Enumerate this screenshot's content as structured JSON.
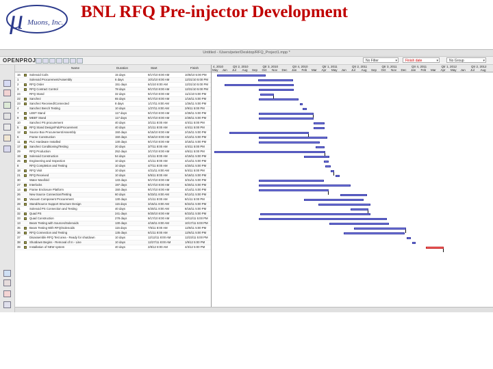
{
  "slide": {
    "title": "BNL RFQ Pre-injector Development",
    "logo": {
      "symbol": "μ",
      "text": "Muons, Inc."
    }
  },
  "window": {
    "path": "Untitled - /Users/peter/Desktop/RFQ_Project1.mpp *",
    "brand": "OPENPROJ",
    "filter_select": "No Filter",
    "sort_select": "Finish date",
    "group_select": "No Group"
  },
  "columns": {
    "id": "",
    "name": "Name",
    "duration": "Duration",
    "start": "Start",
    "finish": "Finish"
  },
  "colors": {
    "bar": "#7b7fe0",
    "critical_bar": "#ff6f6f",
    "title": "#c00000"
  },
  "timeline": {
    "quarters": [
      "4, 2010",
      "Qtr 2, 2010",
      "Qtr 3, 2010",
      "Qtr 4, 2010",
      "Qtr 1, 2011",
      "Qtr 2, 2011",
      "Qtr 3, 2011",
      "Qtr 4, 2011",
      "Qtr 1, 2012",
      "Qtr 2, 2012",
      "Qtr 3, 2012"
    ],
    "months": [
      "May",
      "Jun",
      "Jul",
      "Aug",
      "Sep",
      "Oct",
      "Nov",
      "Dec",
      "Jan",
      "Feb",
      "Mar",
      "Apr",
      "May",
      "Jun",
      "Jul",
      "Aug",
      "Sep",
      "Oct",
      "Nov",
      "Dec",
      "Jan",
      "Feb",
      "Mar",
      "Apr",
      "May",
      "Jun",
      "Jul",
      "Aug"
    ]
  },
  "tasks": [
    {
      "id": "16",
      "name": "Solenoid Coils",
      "duration": "15 days",
      "start": "9/17/10 8:00 AM",
      "finish": "10/8/10 5:00 PM",
      "start_month": 0.3,
      "end_month": 5.2,
      "critical": false
    },
    {
      "id": "1",
      "name": "Solenoid Procurement/Assembly",
      "duration": "6 days",
      "start": "10/1/10 8:00 AM",
      "finish": "12/31/10 5:00 PM",
      "start_month": 4.4,
      "end_month": 7.9,
      "critical": false
    },
    {
      "id": "2",
      "name": "RFQ Order",
      "duration": "151 days",
      "start": "6/1/10 8:00 AM",
      "finish": "12/31/10 5:00 PM",
      "start_month": 1.0,
      "end_month": 8.0,
      "critical": false
    },
    {
      "id": "3",
      "name": "RFQ Contract Control",
      "duration": "78 days",
      "start": "9/17/10 8:00 AM",
      "finish": "12/31/10 5:00 PM",
      "start_month": 4.5,
      "end_month": 8.0,
      "critical": false
    },
    {
      "id": "24",
      "name": "RFQ Stand",
      "duration": "32 days",
      "start": "9/17/10 8:00 AM",
      "finish": "11/1/10 5:00 PM",
      "start_month": 4.6,
      "end_month": 6.0,
      "critical": false
    },
    {
      "id": "22",
      "name": "Sanchez",
      "duration": "65 days",
      "start": "9/17/10 8:00 AM",
      "finish": "1/16/11 5:00 PM",
      "start_month": 4.5,
      "end_month": 8.5,
      "critical": false
    },
    {
      "id": "23",
      "name": "Sanchez Received/Connected",
      "duration": "8 days",
      "start": "1/17/11 8:00 AM",
      "finish": "1/26/11 5:00 PM",
      "start_month": 8.6,
      "end_month": 8.9,
      "critical": false
    },
    {
      "id": "4",
      "name": "Sanchez Bench Testing",
      "duration": "10 days",
      "start": "1/27/11 8:00 AM",
      "finish": "2/9/11 5:00 PM",
      "start_month": 8.9,
      "end_month": 9.3,
      "critical": false
    },
    {
      "id": "7",
      "name": "LEBT Stand",
      "duration": "117 days",
      "start": "9/17/10 8:00 AM",
      "finish": "2/28/11 5:00 PM",
      "start_month": 4.5,
      "end_month": 10.0,
      "critical": false
    },
    {
      "id": "9",
      "name": "MEBT Stand",
      "duration": "117 days",
      "start": "9/17/10 8:00 AM",
      "finish": "2/28/11 5:00 PM",
      "start_month": 4.5,
      "end_month": 10.0,
      "critical": false
    },
    {
      "id": "10",
      "name": "Sanchez PS procurement",
      "duration": "40 days",
      "start": "3/1/11 8:00 AM",
      "finish": "4/4/11 5:00 PM",
      "start_month": 10.0,
      "end_month": 11.1,
      "critical": false
    },
    {
      "id": "5",
      "name": "RFQ Stand Design/Fab/Procurement",
      "duration": "40 days",
      "start": "3/1/11 8:00 AM",
      "finish": "4/4/11 5:00 PM",
      "start_month": 10.0,
      "end_month": 11.1,
      "critical": false
    },
    {
      "id": "12",
      "name": "Source Box Procurement/Assembly",
      "duration": "150 days",
      "start": "6/15/10 8:00 AM",
      "finish": "2/15/11 5:00 PM",
      "start_month": 1.5,
      "end_month": 9.5,
      "critical": false
    },
    {
      "id": "6",
      "name": "Frame Construction",
      "duration": "150 days",
      "start": "9/16/10 8:00 AM",
      "finish": "4/13/11 5:00 PM",
      "start_month": 4.5,
      "end_month": 11.4,
      "critical": false
    },
    {
      "id": "11",
      "name": "PLC Hardware Installed",
      "duration": "130 days",
      "start": "9/17/10 8:00 AM",
      "finish": "3/18/11 5:00 PM",
      "start_month": 4.5,
      "end_month": 10.6,
      "critical": false
    },
    {
      "id": "17",
      "name": "Sanchez Conditioning/Testing",
      "duration": "20 days",
      "start": "3/7/11 8:00 AM",
      "finish": "4/4/11 5:00 PM",
      "start_month": 10.2,
      "end_month": 11.1,
      "critical": false
    },
    {
      "id": "29",
      "name": "RFQ Production",
      "duration": "252 days",
      "start": "3/17/10 8:00 AM",
      "finish": "4/6/11 5:00 PM",
      "start_month": 0.0,
      "end_month": 11.2,
      "critical": false
    },
    {
      "id": "19",
      "name": "Solenoid Construction",
      "duration": "54 days",
      "start": "2/1/11 8:00 AM",
      "finish": "4/19/11 5:00 PM",
      "start_month": 9.0,
      "end_month": 11.6,
      "critical": false
    },
    {
      "id": "25",
      "name": "Engineering and Inspection",
      "duration": "10 days",
      "start": "4/1/11 8:00 AM",
      "finish": "4/14/11 5:00 PM",
      "start_month": 11.0,
      "end_month": 11.5,
      "critical": false
    },
    {
      "id": "8",
      "name": "RFQ Completion and Testing",
      "duration": "10 days",
      "start": "4/7/11 8:00 AM",
      "finish": "4/20/11 5:00 PM",
      "start_month": 11.2,
      "end_month": 11.7,
      "critical": false
    },
    {
      "id": "18",
      "name": "RFQ Visit",
      "duration": "10 days",
      "start": "4/21/11 8:00 AM",
      "finish": "5/4/11 5:00 PM",
      "start_month": 11.7,
      "end_month": 12.1,
      "critical": false
    },
    {
      "id": "21",
      "name": "RFQ Received",
      "duration": "10 days",
      "start": "5/5/11 8:00 AM",
      "finish": "5/18/11 5:00 PM",
      "start_month": 12.2,
      "end_month": 12.6,
      "critical": false
    },
    {
      "id": "30",
      "name": "Water Manifold",
      "duration": "133 days",
      "start": "9/17/10 8:00 AM",
      "finish": "3/31/11 5:00 PM",
      "start_month": 4.5,
      "end_month": 11.0,
      "critical": false
    },
    {
      "id": "27",
      "name": "Interlocks",
      "duration": "197 days",
      "start": "9/17/10 8:00 AM",
      "finish": "6/20/11 5:00 PM",
      "start_month": 4.5,
      "end_month": 13.7,
      "critical": false
    },
    {
      "id": "14",
      "name": "Frame Enclosure Platform",
      "duration": "150 days",
      "start": "9/17/10 8:00 AM",
      "finish": "4/14/11 5:00 PM",
      "start_month": 4.5,
      "end_month": 11.5,
      "critical": false
    },
    {
      "id": "26",
      "name": "New Source Connection/Testing",
      "duration": "60 days",
      "start": "5/23/11 8:00 AM",
      "finish": "8/12/11 5:00 PM",
      "start_month": 12.7,
      "end_month": 15.4,
      "critical": false
    },
    {
      "id": "34",
      "name": "Vacuum Component Procurement",
      "duration": "130 days",
      "start": "2/1/11 8:00 AM",
      "finish": "8/1/11 5:00 PM",
      "start_month": 9.0,
      "end_month": 15.0,
      "critical": false
    },
    {
      "id": "28",
      "name": "Stand/Source Support Structure Design",
      "duration": "115 days",
      "start": "3/15/11 8:00 AM",
      "finish": "8/22/11 5:00 PM",
      "start_month": 10.5,
      "end_month": 15.7,
      "critical": false
    },
    {
      "id": "31",
      "name": "Solenoid PS Connection and Testing",
      "duration": "40 days",
      "start": "6/20/11 8:00 AM",
      "finish": "8/16/11 5:00 PM",
      "start_month": 13.7,
      "end_month": 15.5,
      "critical": false
    },
    {
      "id": "32",
      "name": "Quad PS",
      "duration": "241 days",
      "start": "9/20/10 8:00 AM",
      "finish": "8/23/11 5:00 PM",
      "start_month": 4.6,
      "end_month": 15.7,
      "critical": false
    },
    {
      "id": "33",
      "name": "Quad Construction",
      "duration": "278 days",
      "start": "9/17/10 8:00 AM",
      "finish": "10/12/11 5:00 PM",
      "start_month": 4.5,
      "end_month": 17.4,
      "critical": false
    },
    {
      "id": "13",
      "name": "Beam Testing with Sources/Solenoids",
      "duration": "130 days",
      "start": "4/18/11 8:00 AM",
      "finish": "10/17/11 5:00 PM",
      "start_month": 11.6,
      "end_month": 17.6,
      "critical": false
    },
    {
      "id": "35",
      "name": "Beam Testing With RFQ/Solenoids",
      "duration": "115 days",
      "start": "7/5/11 8:00 AM",
      "finish": "12/9/11 5:00 PM",
      "start_month": 14.1,
      "end_month": 19.3,
      "critical": false
    },
    {
      "id": "36",
      "name": "RFQ Connection and Testing",
      "duration": "135 days",
      "start": "6/1/11 8:00 AM",
      "finish": "12/6/11 5:00 PM",
      "start_month": 13.0,
      "end_month": 19.2,
      "critical": false
    },
    {
      "id": "37",
      "name": "Disassemble RFQ Test area - Ready for shutdown",
      "duration": "10 days",
      "start": "12/12/11 8:00 AM",
      "finish": "12/23/11 5:00 PM",
      "start_month": 19.4,
      "end_month": 19.8,
      "critical": false
    },
    {
      "id": "38",
      "name": "Shutdown Begins - Removal of In - Line",
      "duration": "10 days",
      "start": "12/27/11 8:00 AM",
      "finish": "1/9/12 5:00 PM",
      "start_month": 19.9,
      "end_month": 20.3,
      "critical": false
    },
    {
      "id": "39",
      "name": "Installation of NEW system",
      "duration": "40 days",
      "start": "2/8/12 8:00 AM",
      "finish": "4/3/12 5:00 PM",
      "start_month": 21.3,
      "end_month": 23.1,
      "critical": true
    }
  ]
}
